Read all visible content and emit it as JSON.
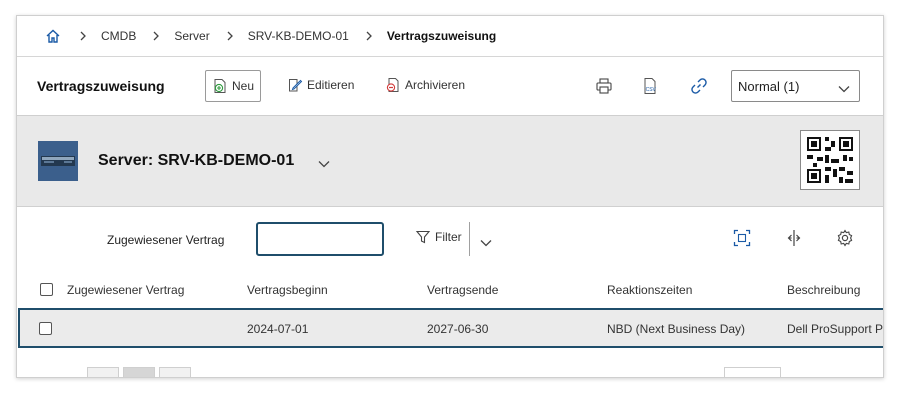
{
  "breadcrumb": {
    "items": [
      "CMDB",
      "Server",
      "SRV-KB-DEMO-01",
      "Vertragszuweisung"
    ]
  },
  "toolbar": {
    "title": "Vertragszuweisung",
    "new_label": "Neu",
    "edit_label": "Editieren",
    "archive_label": "Archivieren",
    "view_select": "Normal (1)"
  },
  "object": {
    "title": "Server: SRV-KB-DEMO-01"
  },
  "filter": {
    "label": "Zugewiesener Vertrag",
    "value": "",
    "button_label": "Filter"
  },
  "table": {
    "columns": [
      "Zugewiesener Vertrag",
      "Vertragsbeginn",
      "Vertragsende",
      "Reaktionszeiten",
      "Beschreibung"
    ],
    "rows": [
      {
        "contract": "",
        "start": "2024-07-01",
        "end": "2027-06-30",
        "reaction": "NBD (Next Business Day)",
        "description": "Dell ProSupport P"
      }
    ]
  },
  "colors": {
    "accent": "#1f4e6b",
    "header_bg": "#e9e9e9",
    "link_blue": "#1a73c8"
  }
}
